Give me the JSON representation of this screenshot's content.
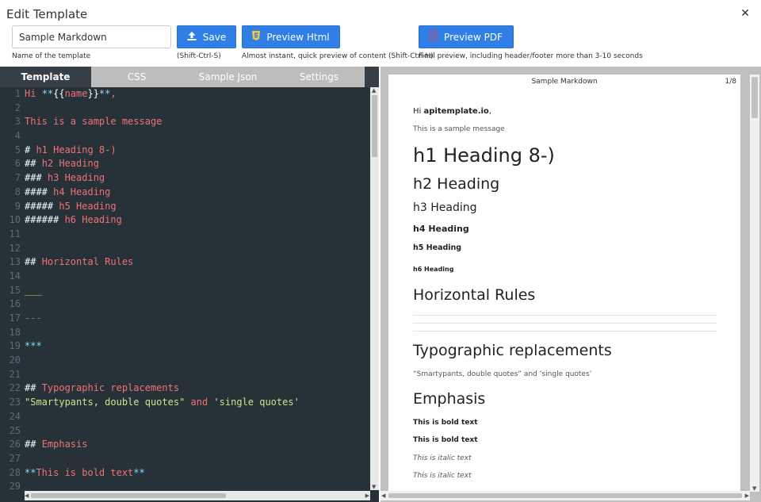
{
  "dialog": {
    "title": "Edit Template"
  },
  "form": {
    "name_value": "Sample Markdown",
    "name_hint": "Name of the template"
  },
  "buttons": {
    "save_label": "Save",
    "save_hint": "(Shift-Ctrl-S)",
    "preview_html_label": "Preview Html",
    "preview_html_hint": "Almost instant, quick preview of content (Shift-Ctrl-H)",
    "preview_pdf_label": "Preview PDF",
    "preview_pdf_hint": "Final preview, including header/footer more than 3-10 seconds"
  },
  "tabs": [
    {
      "label": "Template",
      "active": true
    },
    {
      "label": "CSS",
      "active": false
    },
    {
      "label": "Sample Json",
      "active": false
    },
    {
      "label": "Settings",
      "active": false
    }
  ],
  "editor": {
    "lines": [
      {
        "n": "1",
        "t": "Hi **{{name}}**,"
      },
      {
        "n": "2",
        "t": ""
      },
      {
        "n": "3",
        "t": "This is a sample message"
      },
      {
        "n": "4",
        "t": ""
      },
      {
        "n": "5",
        "t": "# h1 Heading 8-)"
      },
      {
        "n": "6",
        "t": "## h2 Heading"
      },
      {
        "n": "7",
        "t": "### h3 Heading"
      },
      {
        "n": "8",
        "t": "#### h4 Heading"
      },
      {
        "n": "9",
        "t": "##### h5 Heading"
      },
      {
        "n": "10",
        "t": "###### h6 Heading"
      },
      {
        "n": "11",
        "t": ""
      },
      {
        "n": "12",
        "t": ""
      },
      {
        "n": "13",
        "t": "## Horizontal Rules"
      },
      {
        "n": "14",
        "t": ""
      },
      {
        "n": "15",
        "t": "___"
      },
      {
        "n": "16",
        "t": ""
      },
      {
        "n": "17",
        "t": "---"
      },
      {
        "n": "18",
        "t": ""
      },
      {
        "n": "19",
        "t": "***"
      },
      {
        "n": "20",
        "t": ""
      },
      {
        "n": "21",
        "t": ""
      },
      {
        "n": "22",
        "t": "## Typographic replacements"
      },
      {
        "n": "23",
        "t": "\"Smartypants, double quotes\" and 'single quotes'"
      },
      {
        "n": "24",
        "t": ""
      },
      {
        "n": "25",
        "t": ""
      },
      {
        "n": "26",
        "t": "## Emphasis"
      },
      {
        "n": "27",
        "t": ""
      },
      {
        "n": "28",
        "t": "**This is bold text**"
      },
      {
        "n": "29",
        "t": ""
      }
    ]
  },
  "preview": {
    "page_title": "Sample Markdown",
    "page_number": "1/8",
    "greeting_prefix": "Hi ",
    "greeting_name": "apitemplate.io",
    "greeting_suffix": ",",
    "message": "This is a sample message",
    "h1": "h1 Heading 8-)",
    "h2": "h2 Heading",
    "h3": "h3 Heading",
    "h4": "h4 Heading",
    "h5": "h5 Heading",
    "h6": "h6 Heading",
    "hr_heading": "Horizontal Rules",
    "typo_heading": "Typographic replacements",
    "typo_text": "“Smartypants, double quotes” and ‘single quotes’",
    "emphasis_heading": "Emphasis",
    "bold1": "This is bold text",
    "bold2": "This is bold text",
    "italic1": "This is italic text",
    "italic2": "This is italic text"
  },
  "colors": {
    "accent": "#2f7fe6",
    "editor_bg": "#263238",
    "tab_bar": "#bdbdbd"
  }
}
